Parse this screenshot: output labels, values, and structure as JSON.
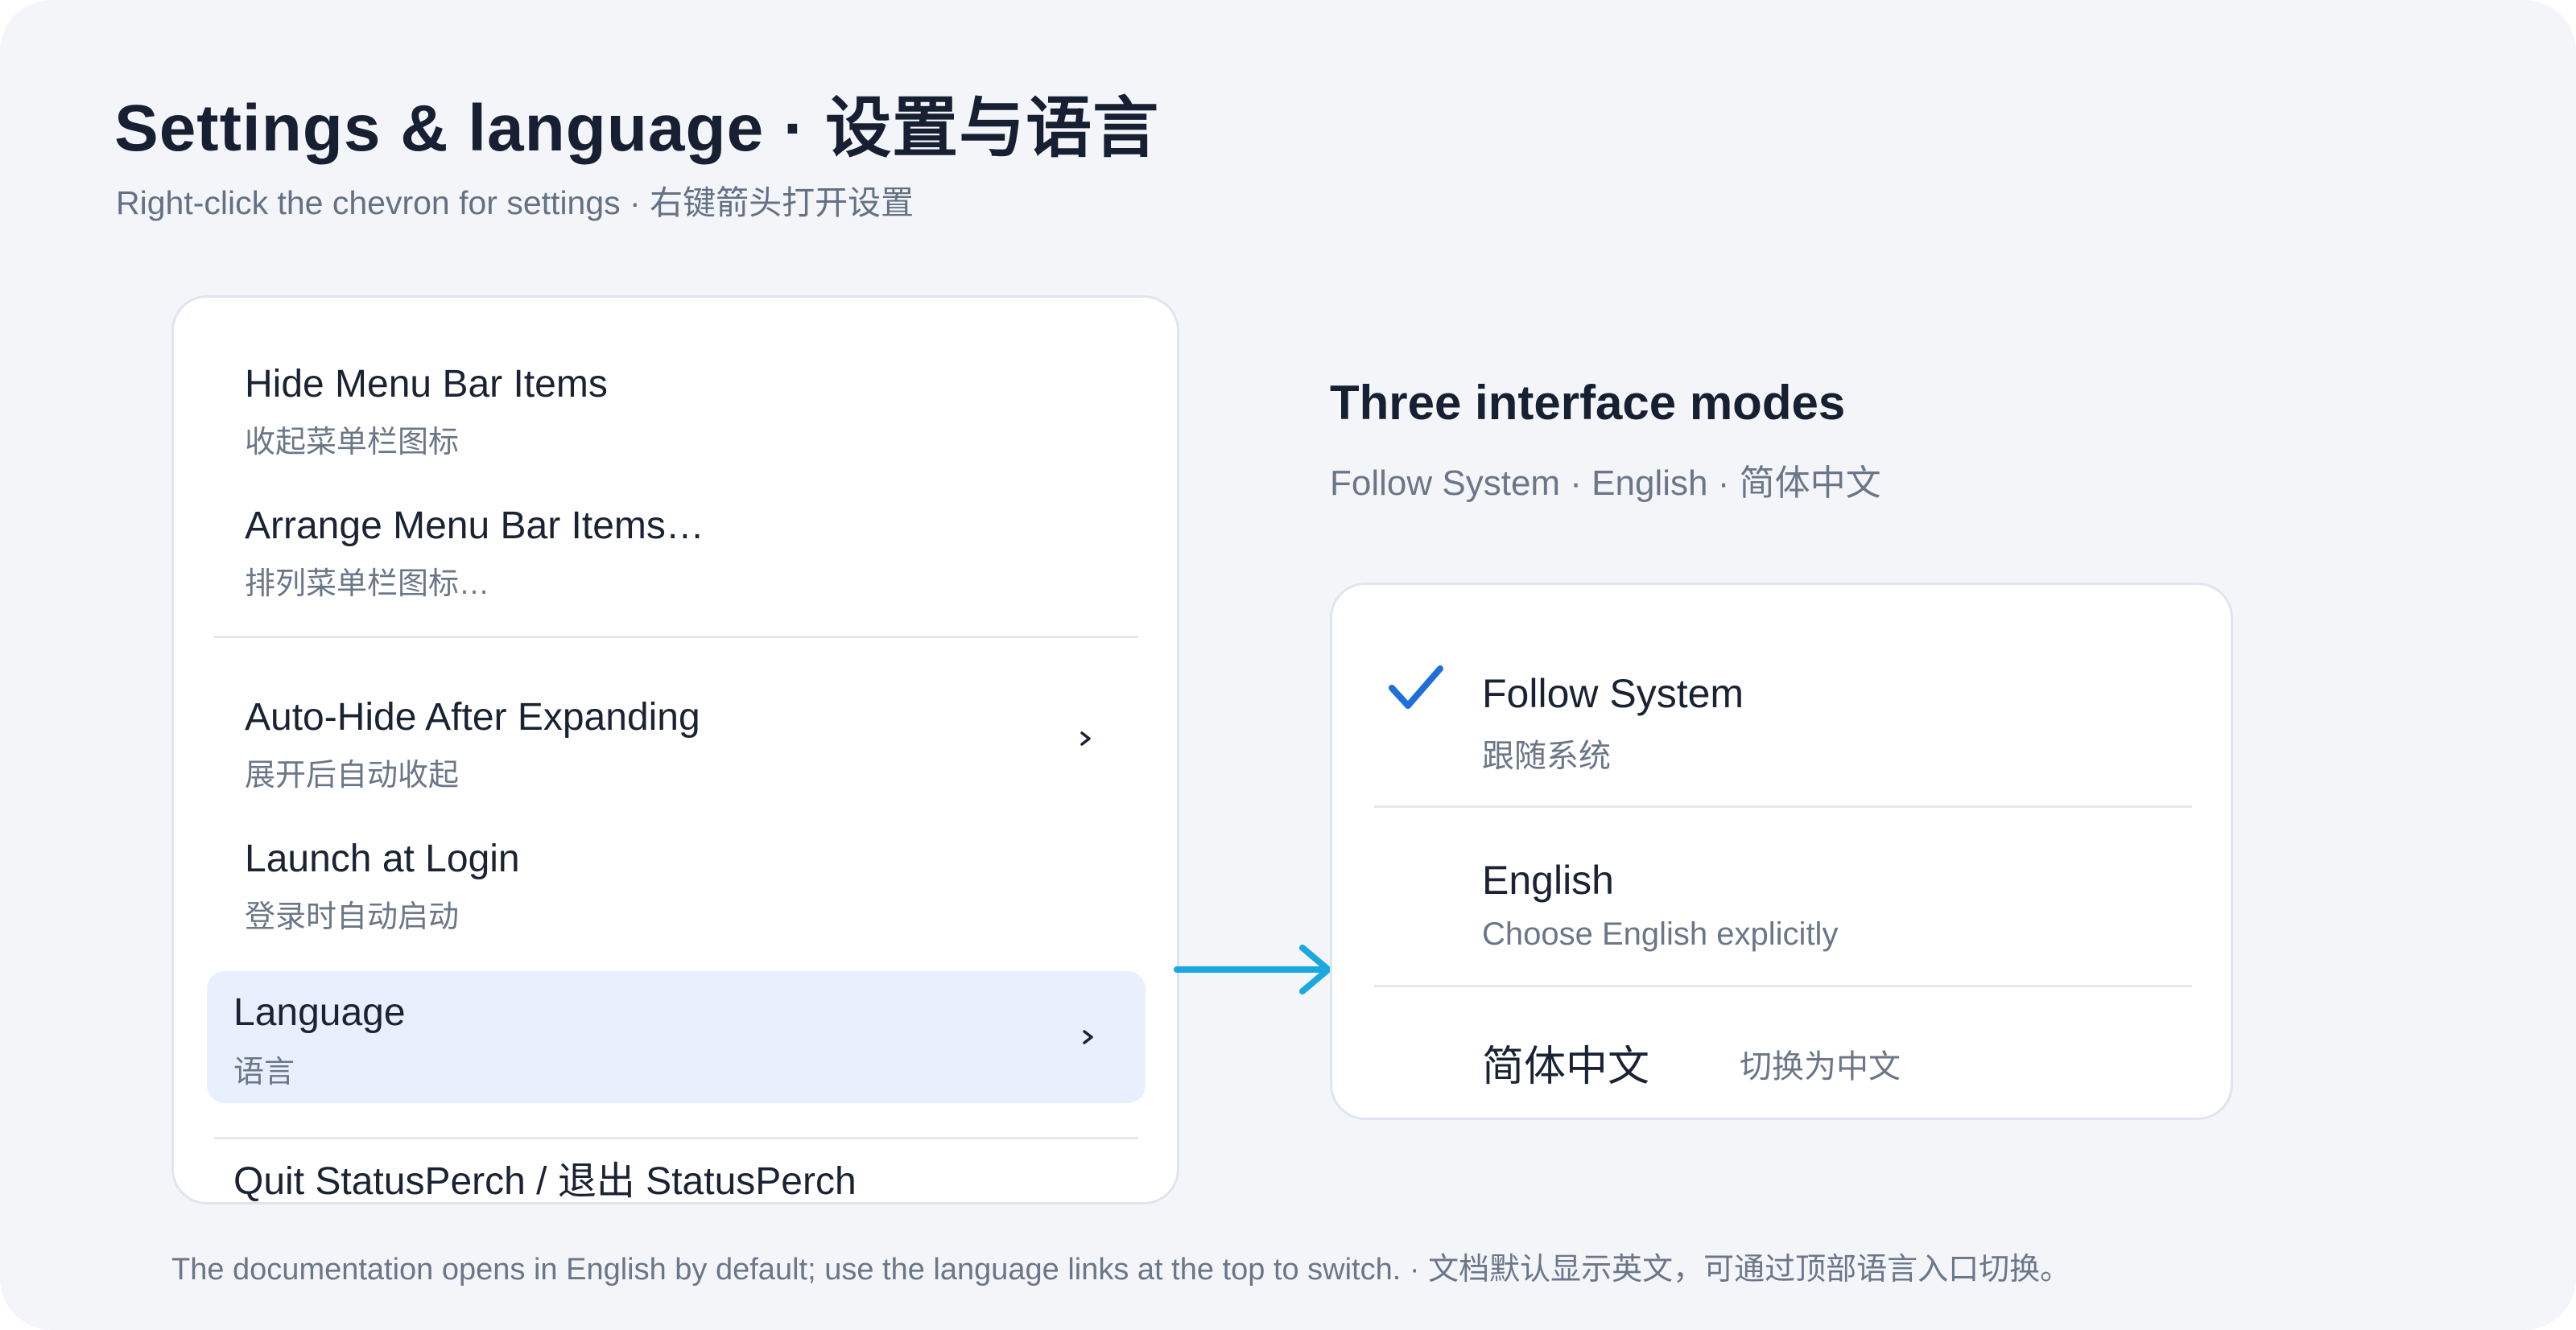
{
  "header": {
    "title": "Settings & language · 设置与语言",
    "subtitle": "Right-click the chevron for settings · 右键箭头打开设置"
  },
  "menu": {
    "items": [
      {
        "label": "Hide Menu Bar Items",
        "label_zh": "收起菜单栏图标"
      },
      {
        "label": "Arrange Menu Bar Items…",
        "label_zh": "排列菜单栏图标…"
      },
      {
        "label": "Auto-Hide After Expanding",
        "label_zh": "展开后自动收起"
      },
      {
        "label": "Launch at Login",
        "label_zh": "登录时自动启动"
      },
      {
        "label": "Language",
        "label_zh": "语言"
      }
    ],
    "quit_label": "Quit StatusPerch / 退出 StatusPerch"
  },
  "modes": {
    "title": "Three interface modes",
    "subtitle": "Follow System · English · 简体中文",
    "options": [
      {
        "name": "Follow System",
        "desc": "跟随系统",
        "checked": true
      },
      {
        "name": "English",
        "desc": "Choose English explicitly",
        "checked": false
      },
      {
        "name": "简体中文",
        "desc": "切换为中文",
        "checked": false
      }
    ]
  },
  "footer": {
    "note": "The documentation opens in English by default; use the language links at the top to switch. · 文档默认显示英文，可通过顶部语言入口切换。"
  },
  "colors": {
    "background": "#f3f5f9",
    "accent": "#1e6fd9",
    "arrow": "#1ba8e0",
    "selected_row": "#e8f0fd"
  },
  "icons": {
    "submenu": "chevron-right-icon",
    "checkmark": "checkmark-icon",
    "connector": "arrow-right-icon"
  }
}
